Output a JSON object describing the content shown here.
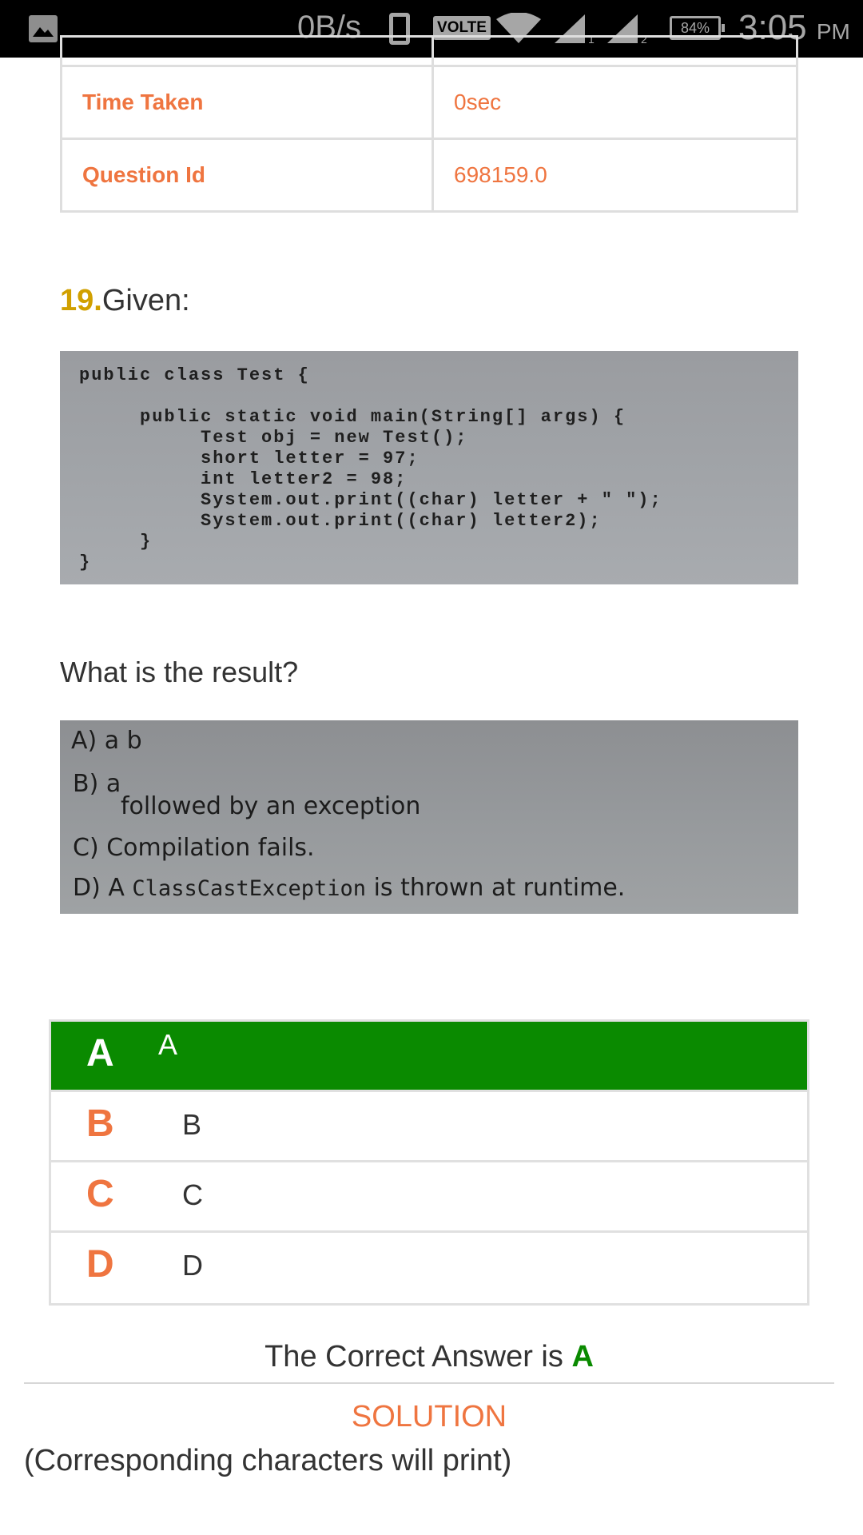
{
  "status_bar": {
    "net_speed": "0B/s",
    "volte": "VOLTE",
    "sim1": "1",
    "sim2": "2",
    "battery": "84%",
    "time": "3:05",
    "ampm": "PM"
  },
  "info_rows": [
    {
      "label": "Time Taken",
      "value": "0sec"
    },
    {
      "label": "Question Id",
      "value": "698159.0"
    }
  ],
  "question": {
    "number": "19.",
    "title": "Given:",
    "code": "public class Test {\n\n     public static void main(String[] args) {\n          Test obj = new Test();\n          short letter = 97;\n          int letter2 = 98;\n          System.out.print((char) letter + \" \");\n          System.out.print((char) letter2);\n     }\n}",
    "prompt": "What is the result?",
    "image_options": {
      "a": "A) a b",
      "b1": "B) a",
      "b2": "followed by an exception",
      "c": "C) Compilation fails.",
      "d_prefix": "D) A",
      "d_mono": "ClassCastException",
      "d_suffix": "is thrown at runtime."
    }
  },
  "choices": [
    {
      "letter": "A",
      "text": "A",
      "correct": true
    },
    {
      "letter": "B",
      "text": "B",
      "correct": false
    },
    {
      "letter": "C",
      "text": "C",
      "correct": false
    },
    {
      "letter": "D",
      "text": "D",
      "correct": false
    }
  ],
  "answer": {
    "prefix": "The Correct Answer is",
    "letter": "A"
  },
  "solution": {
    "title": "SOLUTION",
    "text": "(Corresponding characters will print)"
  },
  "colors": {
    "accent_orange": "#ef7540",
    "correct_green": "#0a8a00",
    "number_gold": "#d1a000"
  }
}
